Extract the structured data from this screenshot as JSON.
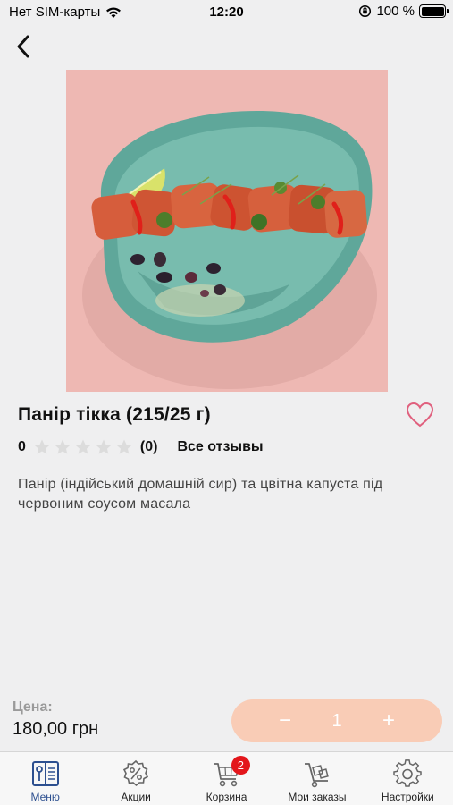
{
  "status_bar": {
    "carrier": "Нет SIM-карты",
    "time": "12:20",
    "battery": "100 %"
  },
  "product": {
    "title": "Панір тікка (215/25 г)",
    "rating_value": "0",
    "rating_stars": 0,
    "review_count": "(0)",
    "all_reviews_label": "Все отзывы",
    "description": "Панір (індійський домашній сир) та цвітна капуста під червоним соусом масала"
  },
  "price": {
    "label": "Цена:",
    "value": "180,00 грн"
  },
  "quantity": {
    "minus": "−",
    "value": "1",
    "plus": "+"
  },
  "tabs": [
    {
      "label": "Меню",
      "icon": "menu-book-icon",
      "active": true
    },
    {
      "label": "Акции",
      "icon": "discount-icon",
      "active": false
    },
    {
      "label": "Корзина",
      "icon": "cart-icon",
      "active": false,
      "badge": "2"
    },
    {
      "label": "Мои заказы",
      "icon": "orders-trolley-icon",
      "active": false
    },
    {
      "label": "Настройки",
      "icon": "gear-icon",
      "active": false
    }
  ],
  "colors": {
    "accent": "#f9ccb6",
    "active_tab": "#2c4f8f",
    "badge": "#e3161b",
    "favorite": "#e0607e",
    "image_background": "#eeb8b3"
  }
}
